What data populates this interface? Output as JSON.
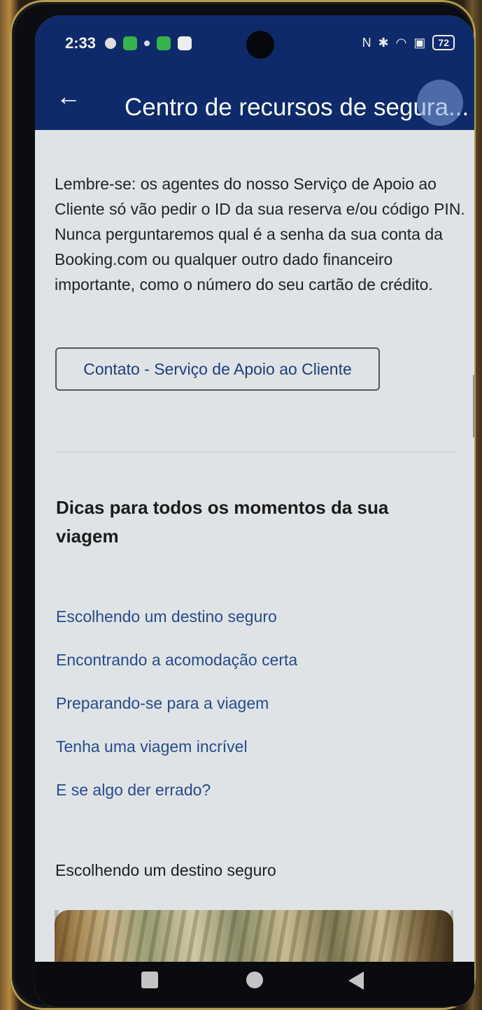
{
  "status_bar": {
    "time": "2:33",
    "battery": "72",
    "icons": [
      "settings-icon",
      "app-icon-green",
      "dot-icon",
      "app-icon-green",
      "app-icon-white",
      "nfc-icon",
      "bluetooth-icon",
      "wifi-icon",
      "sim-icon",
      "battery-icon"
    ]
  },
  "app_bar": {
    "back_icon": "arrow-left-icon",
    "title": "Centro de recursos de segura..."
  },
  "main": {
    "notice": "Lembre-se: os agentes do nosso Serviço de Apoio ao Cliente só vão pedir o ID da sua reserva e/ou código PIN. Nunca perguntaremos qual é a senha da sua conta da Booking.com ou qualquer outro dado financeiro importante, como o número do seu cartão de crédito.",
    "contact_button": "Contato - Serviço de Apoio ao Cliente",
    "tips_title": "Dicas para todos os momentos da sua viagem",
    "tips": [
      {
        "label": "Escolhendo um destino seguro"
      },
      {
        "label": "Encontrando a acomodação certa"
      },
      {
        "label": "Preparando-se para a viagem"
      },
      {
        "label": "Tenha uma viagem incrível"
      },
      {
        "label": "E se algo der errado?"
      }
    ],
    "section_heading": "Escolhendo um destino seguro"
  },
  "nav_bar": {
    "recent_icon": "square-icon",
    "home_icon": "circle-icon",
    "back_icon": "triangle-back-icon"
  },
  "colors": {
    "app_bar": "#0e2a6b",
    "link": "#274a8c",
    "background": "#dfe3e6"
  }
}
